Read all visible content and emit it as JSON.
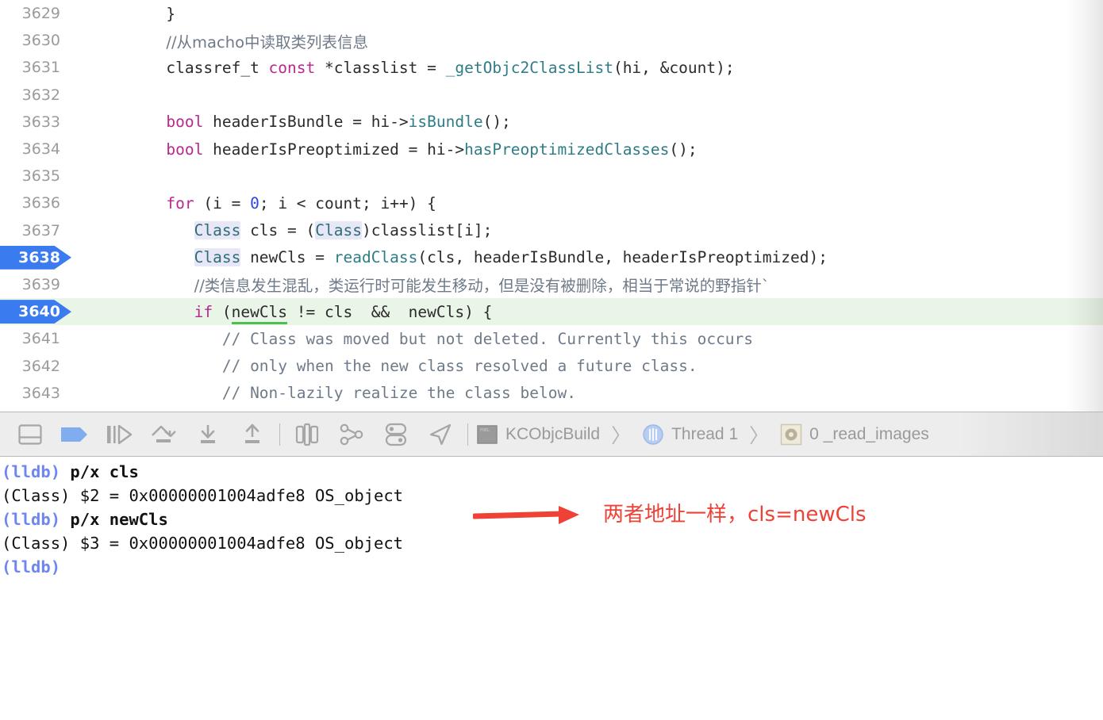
{
  "editor": {
    "lines": [
      {
        "num": "3629",
        "breakpoint": false,
        "current": false,
        "indent": 10,
        "tokens": [
          {
            "t": "}",
            "c": "plain"
          }
        ]
      },
      {
        "num": "3630",
        "breakpoint": false,
        "current": false,
        "indent": 10,
        "tokens": [
          {
            "t": "//从macho中读取类列表信息",
            "c": "cmt-cjk"
          }
        ]
      },
      {
        "num": "3631",
        "breakpoint": false,
        "current": false,
        "indent": 10,
        "tokens": [
          {
            "t": "classref_t ",
            "c": "plain"
          },
          {
            "t": "const",
            "c": "kw"
          },
          {
            "t": " *classlist = ",
            "c": "plain"
          },
          {
            "t": "_getObjc2ClassList",
            "c": "fn"
          },
          {
            "t": "(hi, &count);",
            "c": "plain"
          }
        ]
      },
      {
        "num": "3632",
        "breakpoint": false,
        "current": false,
        "indent": 10,
        "tokens": []
      },
      {
        "num": "3633",
        "breakpoint": false,
        "current": false,
        "indent": 10,
        "tokens": [
          {
            "t": "bool",
            "c": "kw"
          },
          {
            "t": " headerIsBundle = hi->",
            "c": "plain"
          },
          {
            "t": "isBundle",
            "c": "fn"
          },
          {
            "t": "();",
            "c": "plain"
          }
        ]
      },
      {
        "num": "3634",
        "breakpoint": false,
        "current": false,
        "indent": 10,
        "tokens": [
          {
            "t": "bool",
            "c": "kw"
          },
          {
            "t": " headerIsPreoptimized = hi->",
            "c": "plain"
          },
          {
            "t": "hasPreoptimizedClasses",
            "c": "fn"
          },
          {
            "t": "();",
            "c": "plain"
          }
        ]
      },
      {
        "num": "3635",
        "breakpoint": false,
        "current": false,
        "indent": 10,
        "tokens": []
      },
      {
        "num": "3636",
        "breakpoint": false,
        "current": false,
        "indent": 10,
        "tokens": [
          {
            "t": "for",
            "c": "kw"
          },
          {
            "t": " (i = ",
            "c": "plain"
          },
          {
            "t": "0",
            "c": "num"
          },
          {
            "t": "; i < count; i++) {",
            "c": "plain"
          }
        ]
      },
      {
        "num": "3637",
        "breakpoint": false,
        "current": false,
        "indent": 13,
        "tokens": [
          {
            "t": "Class",
            "c": "type-hl"
          },
          {
            "t": " cls = (",
            "c": "plain"
          },
          {
            "t": "Class",
            "c": "type-hl"
          },
          {
            "t": ")classlist[i];",
            "c": "plain"
          }
        ]
      },
      {
        "num": "3638",
        "breakpoint": true,
        "current": false,
        "indent": 13,
        "tokens": [
          {
            "t": "Class",
            "c": "type-hl"
          },
          {
            "t": " newCls = ",
            "c": "plain"
          },
          {
            "t": "readClass",
            "c": "fn"
          },
          {
            "t": "(cls, headerIsBundle, headerIsPreoptimized);",
            "c": "plain"
          }
        ]
      },
      {
        "num": "3639",
        "breakpoint": false,
        "current": false,
        "indent": 13,
        "tokens": [
          {
            "t": "//类信息发生混乱，类运行时可能发生移动，但是没有被删除，相当于常说的野指针`",
            "c": "cmt-cjk"
          }
        ]
      },
      {
        "num": "3640",
        "breakpoint": true,
        "current": true,
        "indent": 13,
        "tokens": [
          {
            "t": "if",
            "c": "kw"
          },
          {
            "t": " (",
            "c": "plain"
          },
          {
            "t": "newCls",
            "c": "uline"
          },
          {
            "t": " != cls  &&  newCls) {",
            "c": "plain"
          }
        ]
      },
      {
        "num": "3641",
        "breakpoint": false,
        "current": false,
        "indent": 16,
        "tokens": [
          {
            "t": "// Class was moved but not deleted. Currently this occurs",
            "c": "cmt"
          }
        ]
      },
      {
        "num": "3642",
        "breakpoint": false,
        "current": false,
        "indent": 16,
        "tokens": [
          {
            "t": "// only when the new class resolved a future class.",
            "c": "cmt"
          }
        ]
      },
      {
        "num": "3643",
        "breakpoint": false,
        "current": false,
        "indent": 16,
        "tokens": [
          {
            "t": "// Non-lazily realize the class below.",
            "c": "cmt"
          }
        ]
      }
    ]
  },
  "debugbar": {
    "buttons": [
      {
        "name": "toggle-debug-area-button",
        "icon": "panel-toggle-icon",
        "label": "Hide/Show Debug Area"
      },
      {
        "name": "breakpoints-toggle-button",
        "icon": "breakpoint-flag-icon",
        "label": "Activate Breakpoints"
      },
      {
        "name": "continue-button",
        "icon": "continue-icon",
        "label": "Continue program execution"
      },
      {
        "name": "step-over-button",
        "icon": "step-over-icon",
        "label": "Step over"
      },
      {
        "name": "step-into-button",
        "icon": "step-into-icon",
        "label": "Step into"
      },
      {
        "name": "step-out-button",
        "icon": "step-out-icon",
        "label": "Step out"
      },
      {
        "name": "view-hierarchy-button",
        "icon": "view-hierarchy-icon",
        "label": "Debug View Hierarchy"
      },
      {
        "name": "memory-graph-button",
        "icon": "memory-graph-icon",
        "label": "Debug Memory Graph"
      },
      {
        "name": "environment-overrides-button",
        "icon": "environment-overrides-icon",
        "label": "Environment Overrides"
      },
      {
        "name": "simulate-location-button",
        "icon": "location-arrow-icon",
        "label": "Simulate Location"
      }
    ],
    "breadcrumb": {
      "process": "KCObjcBuild",
      "thread": "Thread 1",
      "frame": "0 _read_images",
      "separator": "〉"
    }
  },
  "console": {
    "lines": [
      {
        "prompt": "(lldb)",
        "cmd": " p/x cls",
        "result": ""
      },
      {
        "prompt": "",
        "cmd": "",
        "result": "(Class) $2 = 0x00000001004adfe8 OS_object"
      },
      {
        "prompt": "(lldb)",
        "cmd": " p/x newCls",
        "result": ""
      },
      {
        "prompt": "",
        "cmd": "",
        "result": "(Class) $3 = 0x00000001004adfe8 OS_object"
      },
      {
        "prompt": "(lldb)",
        "cmd": "",
        "result": ""
      }
    ]
  },
  "annotation": {
    "text": "两者地址一样，cls=newCls",
    "color": "#ef4136",
    "arrow": "red-arrow-icon"
  },
  "colors": {
    "breakpoint_blue": "#3a7bf0",
    "current_line_green": "#e9f5e7",
    "keyword_magenta": "#b8288f",
    "type_teal": "#2d6f74",
    "comment_gray": "#6f7a89",
    "prompt_blue": "#6e86f0",
    "annotation_red": "#ef4136",
    "toolbar_gray": "#ededed"
  }
}
